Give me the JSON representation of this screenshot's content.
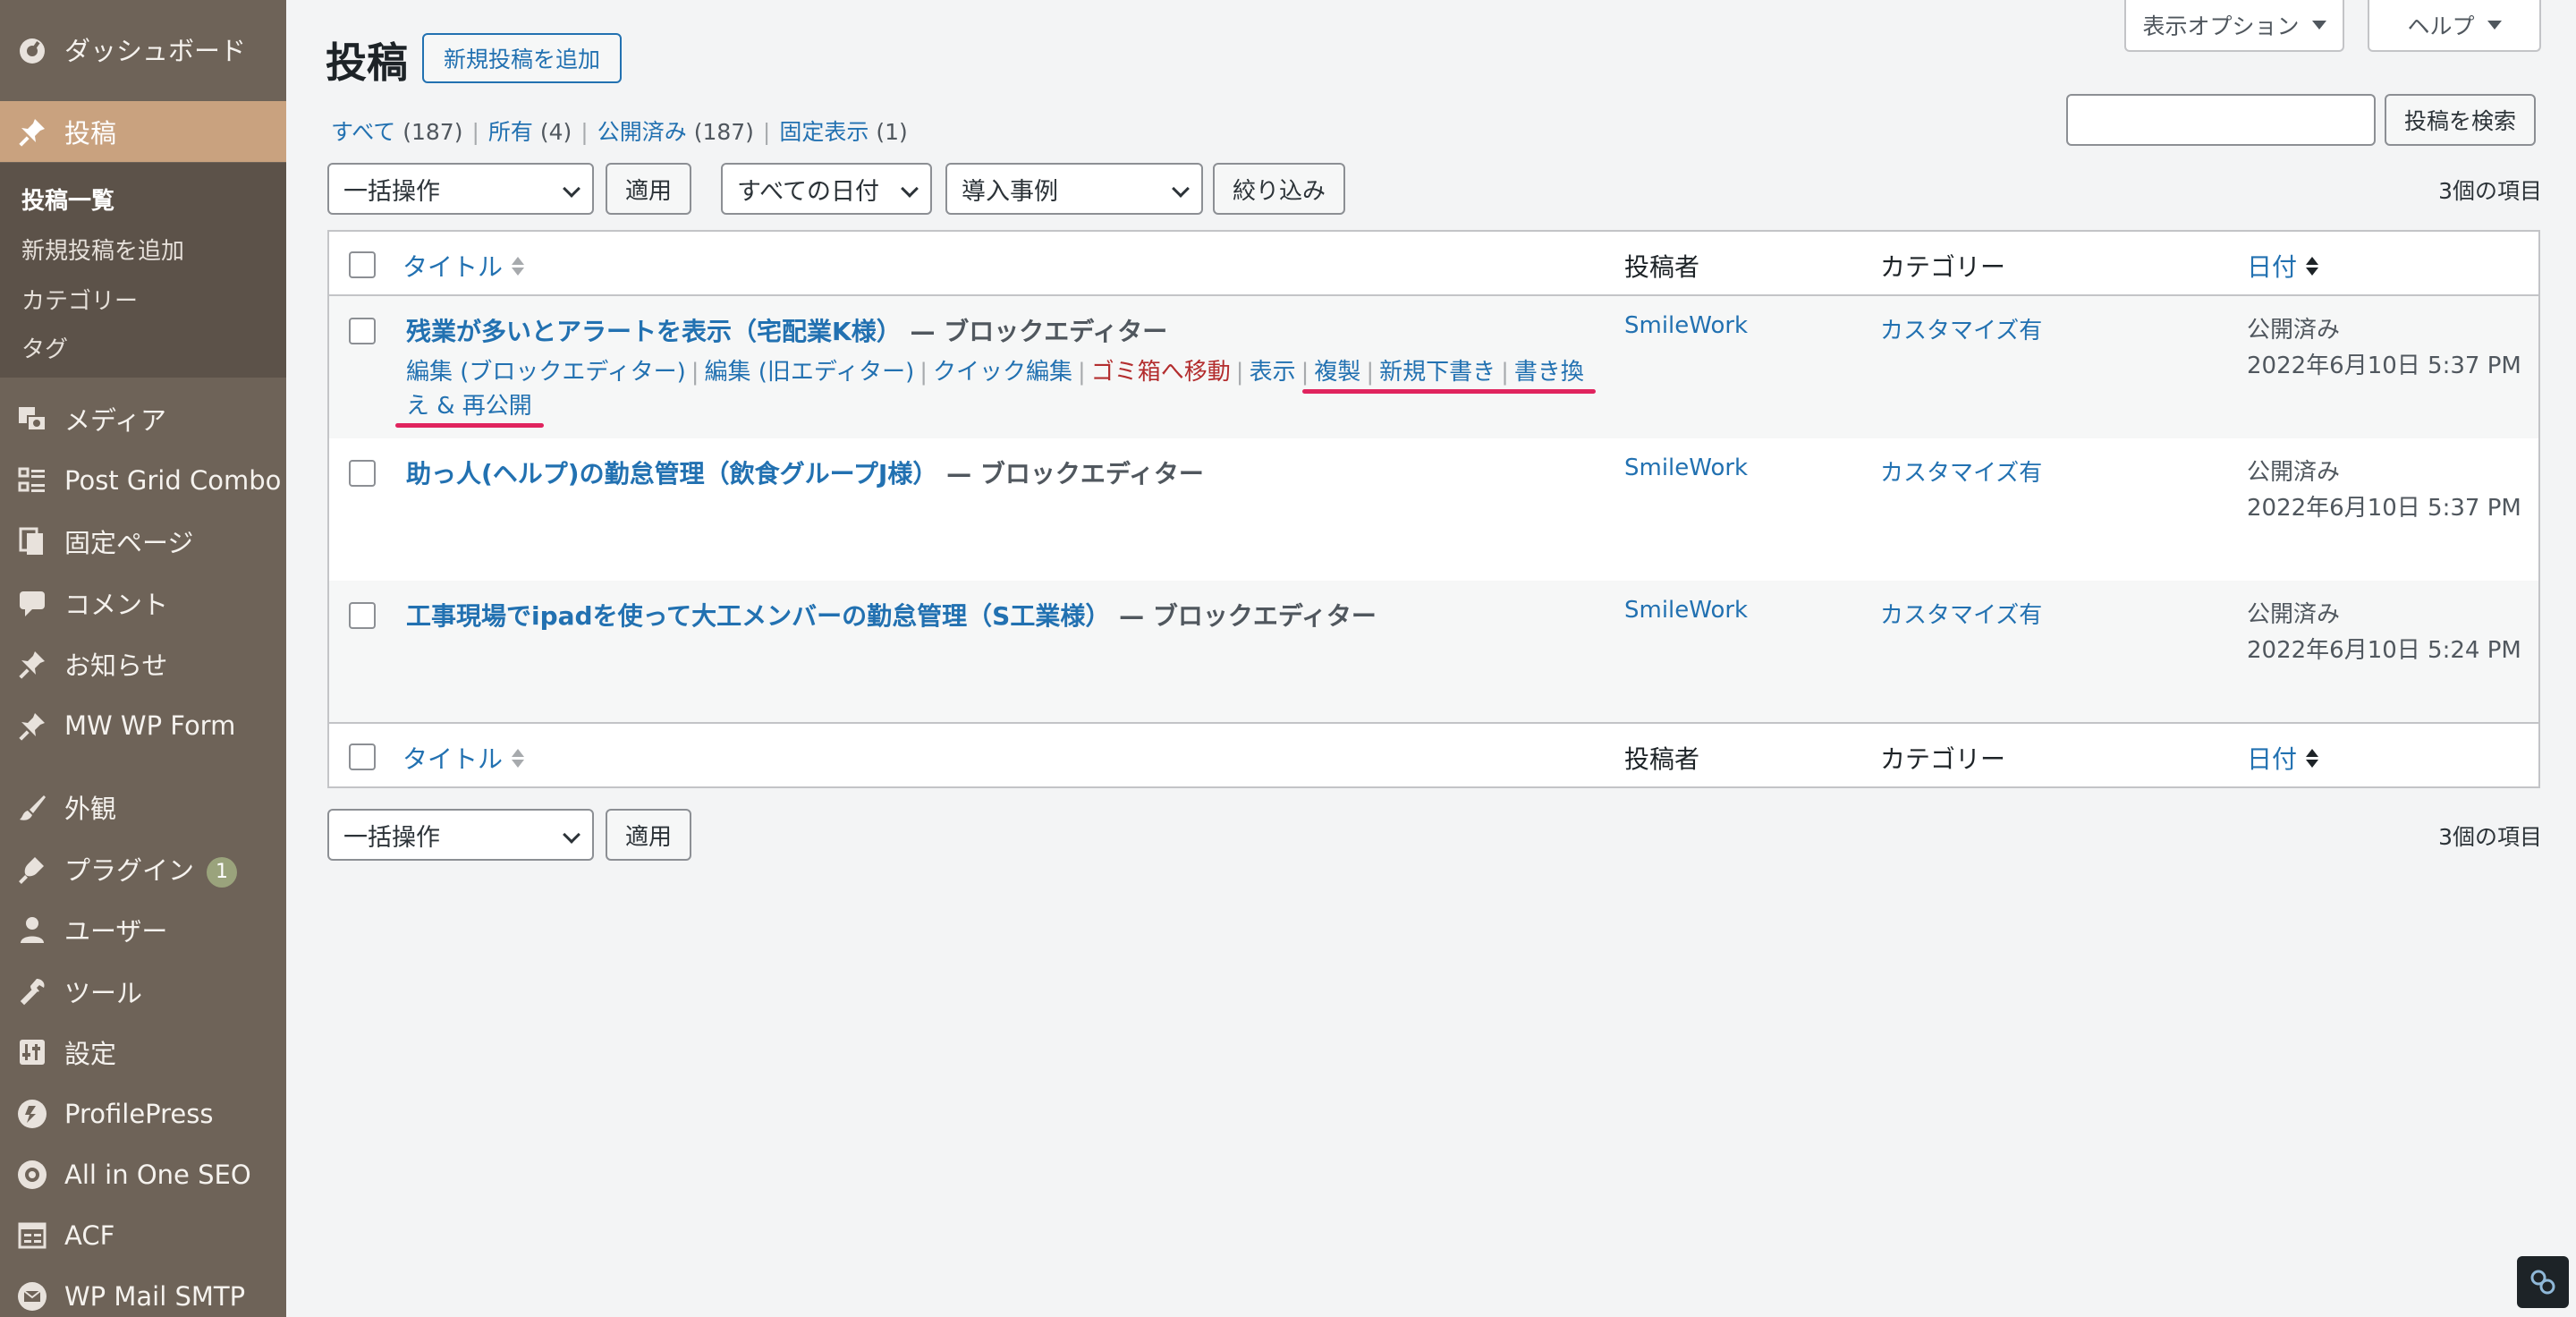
{
  "sidebar": {
    "items": [
      {
        "label": "ダッシュボード",
        "icon": "dashboard-icon"
      },
      {
        "label": "投稿",
        "icon": "pin-icon"
      },
      {
        "label": "メディア",
        "icon": "media-icon"
      },
      {
        "label": "Post Grid Combo",
        "icon": "grid-icon"
      },
      {
        "label": "固定ページ",
        "icon": "pages-icon"
      },
      {
        "label": "コメント",
        "icon": "comment-icon"
      },
      {
        "label": "お知らせ",
        "icon": "pin-icon"
      },
      {
        "label": "MW WP Form",
        "icon": "pin-icon"
      },
      {
        "label": "外観",
        "icon": "brush-icon"
      },
      {
        "label": "プラグイン",
        "icon": "plug-icon",
        "badge": "1"
      },
      {
        "label": "ユーザー",
        "icon": "user-icon"
      },
      {
        "label": "ツール",
        "icon": "wrench-icon"
      },
      {
        "label": "設定",
        "icon": "settings-icon"
      },
      {
        "label": "ProfilePress",
        "icon": "profilepress-icon"
      },
      {
        "label": "All in One SEO",
        "icon": "seo-icon"
      },
      {
        "label": "ACF",
        "icon": "acf-icon"
      },
      {
        "label": "WP Mail SMTP",
        "icon": "mail-icon"
      }
    ],
    "submenu": [
      "投稿一覧",
      "新規投稿を追加",
      "カテゴリー",
      "タグ"
    ]
  },
  "screen_tabs": {
    "options": "表示オプション",
    "help": "ヘルプ"
  },
  "header": {
    "title": "投稿",
    "add_new": "新規投稿を追加"
  },
  "filters_links": [
    {
      "label": "すべて",
      "count": "(187)"
    },
    {
      "label": "所有",
      "count": "(4)"
    },
    {
      "label": "公開済み",
      "count": "(187)"
    },
    {
      "label": "固定表示",
      "count": "(1)"
    }
  ],
  "search": {
    "button": "投稿を検索",
    "placeholder": ""
  },
  "toolbar": {
    "bulk_action": "一括操作",
    "apply": "適用",
    "date_filter": "すべての日付",
    "category_filter": "導入事例",
    "filter_btn": "絞り込み",
    "items_count": "3個の項目"
  },
  "table": {
    "columns": {
      "title": "タイトル",
      "author": "投稿者",
      "category": "カテゴリー",
      "date": "日付"
    },
    "rows": [
      {
        "title": "残業が多いとアラートを表示（宅配業K様）",
        "state": " — ブロックエディター",
        "author": "SmileWork",
        "category": "カスタマイズ有",
        "status": "公開済み",
        "date": "2022年6月10日 5:37 PM"
      },
      {
        "title": "助っ人(ヘルプ)の勤怠管理（飲食グループJ様）",
        "state": " — ブロックエディター",
        "author": "SmileWork",
        "category": "カスタマイズ有",
        "status": "公開済み",
        "date": "2022年6月10日 5:37 PM"
      },
      {
        "title": "工事現場でipadを使って大工メンバーの勤怠管理（S工業様）",
        "state": " — ブロックエディター",
        "author": "SmileWork",
        "category": "カスタマイズ有",
        "status": "公開済み",
        "date": "2022年6月10日 5:24 PM"
      }
    ],
    "row_actions": {
      "edit_block": "編集 (ブロックエディター)",
      "edit_classic": "編集 (旧エディター)",
      "quick_edit": "クイック編集",
      "trash": "ゴミ箱へ移動",
      "view": "表示",
      "duplicate": "複製",
      "new_draft": "新規下書き",
      "rewrite": "書き換え & 再公開"
    }
  },
  "colors": {
    "sidebar": "#6e6358",
    "current": "#c9a27f",
    "link": "#2271b1",
    "trash": "#b32d2e",
    "highlight": "#e0245e"
  }
}
